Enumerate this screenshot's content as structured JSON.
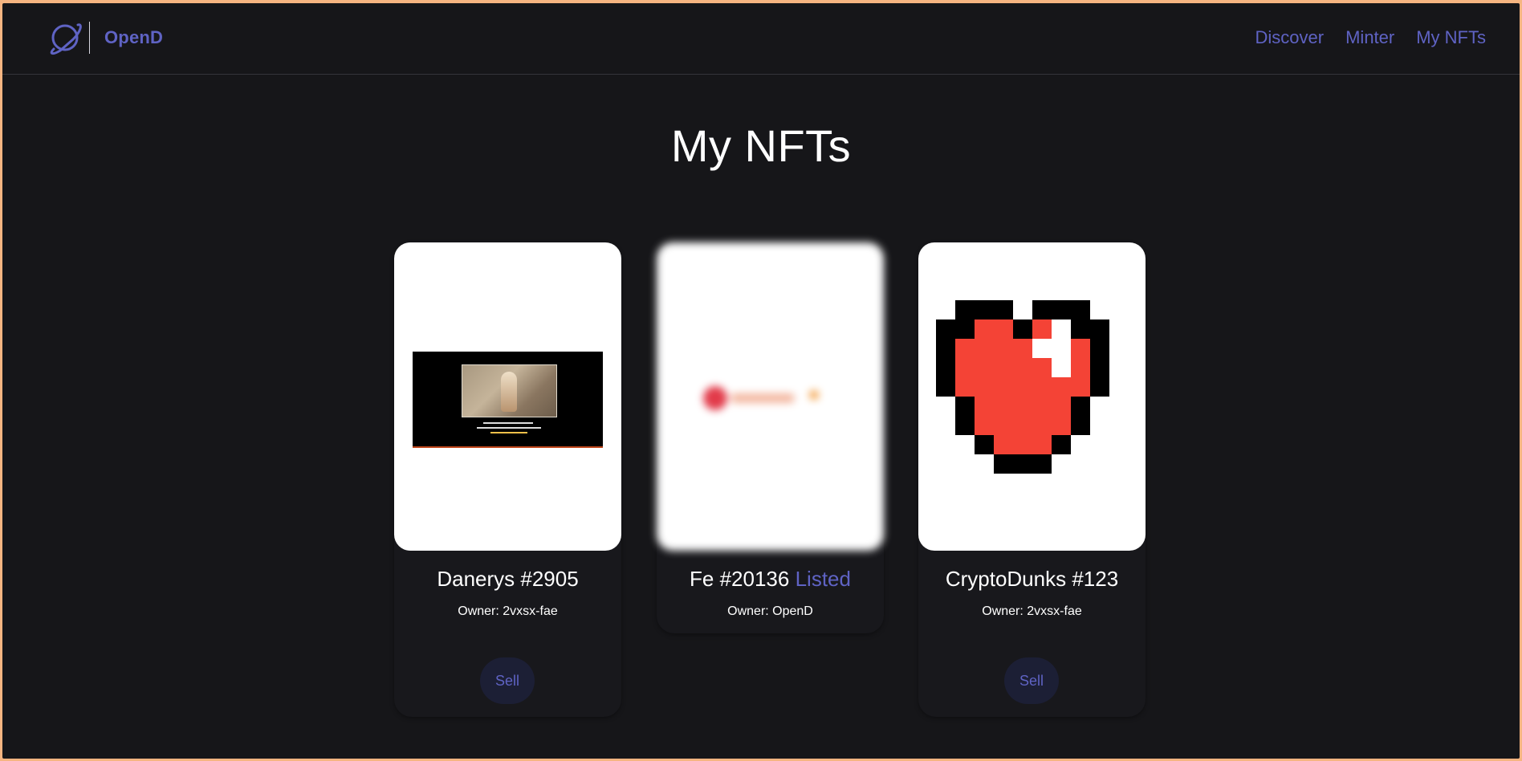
{
  "app": {
    "brand": "OpenD",
    "accent_color": "#5f63c4",
    "background_color": "#161619",
    "logo_icon": "planet-icon"
  },
  "nav": {
    "items": [
      "Discover",
      "Minter",
      "My NFTs"
    ]
  },
  "page": {
    "title": "My NFTs"
  },
  "cards": [
    {
      "name": "Danerys #2905",
      "status": "",
      "owner": "Owner: 2vxsx-fae",
      "button": "Sell",
      "image": "daenerys-photo-screenshot"
    },
    {
      "name": "Fe #20136",
      "status": "Listed",
      "owner": "Owner: OpenD",
      "button": "",
      "image": "blurred-logo"
    },
    {
      "name": "CryptoDunks #123",
      "status": "",
      "owner": "Owner: 2vxsx-fae",
      "button": "Sell",
      "image": "pixel-heart"
    }
  ]
}
